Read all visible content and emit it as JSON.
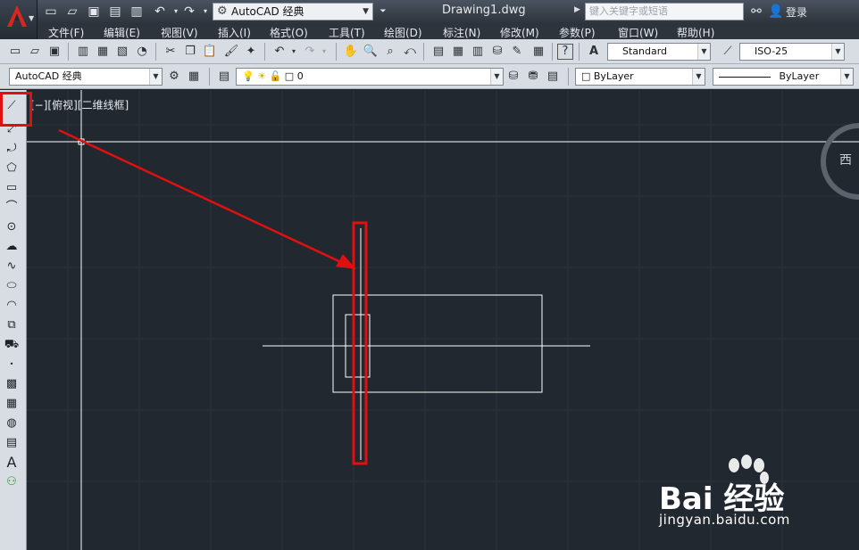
{
  "titlebar": {
    "workspace": "AutoCAD 经典",
    "document": "Drawing1.dwg",
    "search_placeholder": "键入关键字或短语",
    "login": "登录"
  },
  "menus": [
    "文件(F)",
    "编辑(E)",
    "视图(V)",
    "插入(I)",
    "格式(O)",
    "工具(T)",
    "绘图(D)",
    "标注(N)",
    "修改(M)",
    "参数(P)",
    "窗口(W)",
    "帮助(H)"
  ],
  "toolbar1": {
    "text_style": "Standard",
    "dim_style": "ISO-25"
  },
  "toolbar2": {
    "workspace": "AutoCAD 经典",
    "layer": "0",
    "color": "ByLayer",
    "linetype": "ByLayer"
  },
  "viewport": {
    "label": "[−][俯视][二维线框]",
    "viewcube_direction": "西"
  },
  "left_toolbar": {
    "text_tool_glyph": "A"
  },
  "watermark": {
    "brand": "Bai 经验",
    "url": "jingyan.baidu.com"
  },
  "colors": {
    "canvas": "#212830",
    "annotation": "#e01010",
    "geometry": "#ffffff"
  }
}
